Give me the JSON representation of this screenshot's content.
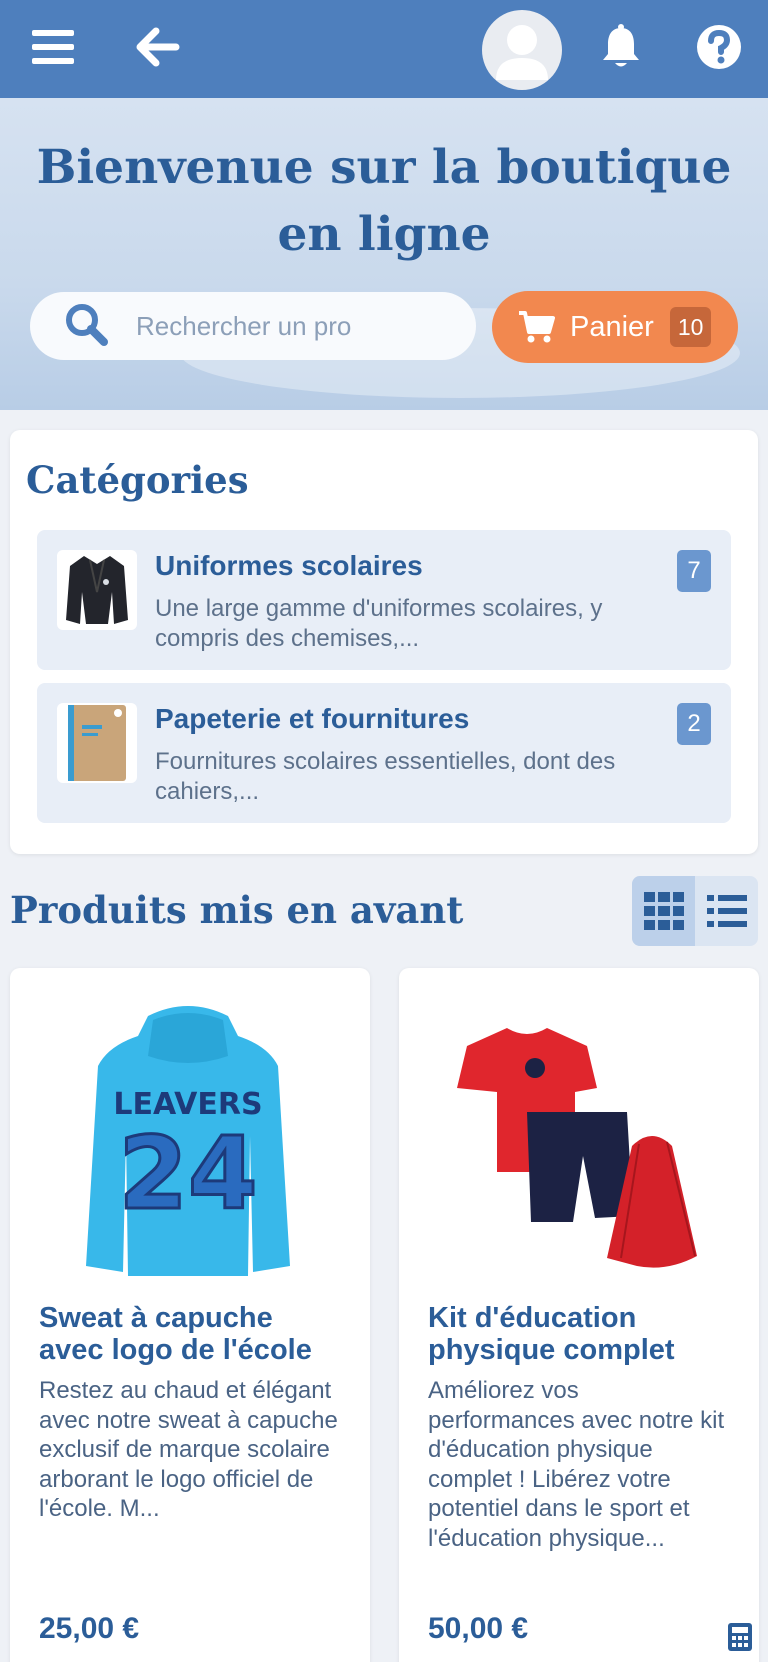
{
  "topbar": {
    "menu_icon": "menu-icon",
    "back_icon": "arrow-left-icon",
    "avatar_icon": "user-avatar-icon",
    "bell_icon": "bell-icon",
    "help_icon": "question-circle-icon"
  },
  "hero": {
    "title": "Bienvenue sur la boutique en ligne",
    "search_placeholder": "Rechercher un pro",
    "cart_label": "Panier",
    "cart_count": "10"
  },
  "categories": {
    "title": "Catégories",
    "items": [
      {
        "name": "Uniformes scolaires",
        "description": "Une large gamme d'uniformes scolaires, y compris des chemises,...",
        "count": "7",
        "thumb": "blazer-image"
      },
      {
        "name": "Papeterie et fournitures",
        "description": "Fournitures scolaires essentielles, dont des cahiers,...",
        "count": "2",
        "thumb": "notebook-image"
      }
    ]
  },
  "featured": {
    "title": "Produits mis en avant",
    "view_modes": [
      "grid-view-icon",
      "list-view-icon"
    ],
    "active_view": "grid",
    "products": [
      {
        "name": "Sweat à capuche avec logo de l'école",
        "description": "Restez au chaud et élégant avec notre sweat à capuche exclusif de marque scolaire arborant le logo officiel de l'école. M...",
        "price": "25,00 €",
        "image_text_1": "LEAVERS",
        "image_text_2": "24"
      },
      {
        "name": "Kit d'éducation physique complet",
        "description": "Améliorez vos performances avec notre kit d'éducation physique complet ! Libérez votre potentiel dans le sport et l'éducation physique...",
        "price": "50,00 €"
      }
    ]
  },
  "colors": {
    "primary": "#2b5d98",
    "topbar": "#4e7fbd",
    "cart": "#f2884f",
    "badge": "#6b97cf"
  }
}
